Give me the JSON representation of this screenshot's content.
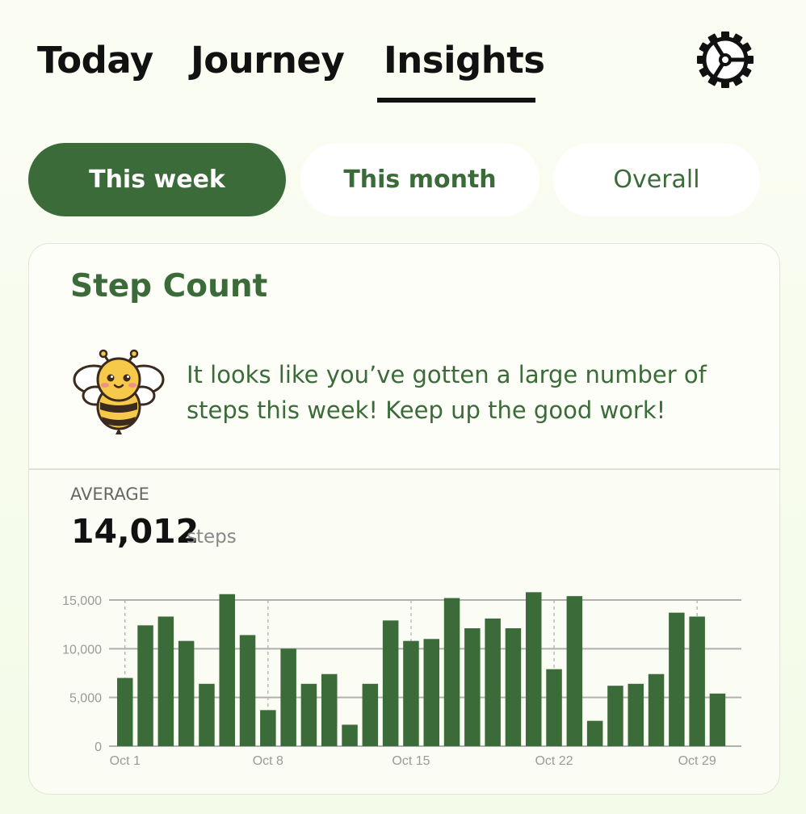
{
  "tabs": {
    "today": "Today",
    "journey": "Journey",
    "insights": "Insights",
    "active": "Insights"
  },
  "filters": {
    "this_week": "This week",
    "this_month": "This month",
    "overall": "Overall",
    "selected": "This week"
  },
  "card": {
    "title": "Step Count",
    "message": "It looks like you’ve gotten a large number of steps this week! Keep up the good work!",
    "average_label": "AVERAGE",
    "average_value": "14,012",
    "average_unit": "steps"
  },
  "icons": {
    "settings": "gear-icon",
    "mascot": "bee-icon"
  },
  "colors": {
    "accent": "#3a6b39",
    "bar": "#3a6b39"
  },
  "chart_data": {
    "type": "bar",
    "categories": [
      "Oct 1",
      "Oct 2",
      "Oct 3",
      "Oct 4",
      "Oct 5",
      "Oct 6",
      "Oct 7",
      "Oct 8",
      "Oct 9",
      "Oct 10",
      "Oct 11",
      "Oct 12",
      "Oct 13",
      "Oct 14",
      "Oct 15",
      "Oct 16",
      "Oct 17",
      "Oct 18",
      "Oct 19",
      "Oct 20",
      "Oct 21",
      "Oct 22",
      "Oct 23",
      "Oct 24",
      "Oct 25",
      "Oct 26",
      "Oct 27",
      "Oct 28",
      "Oct 29",
      "Oct 30"
    ],
    "values": [
      7000,
      12400,
      13300,
      10800,
      6400,
      15600,
      11400,
      3700,
      10000,
      6400,
      7400,
      2200,
      6400,
      12900,
      10800,
      11000,
      15200,
      12100,
      13100,
      12100,
      15800,
      7900,
      15400,
      2600,
      6200,
      6400,
      7400,
      13700,
      13300,
      5400
    ],
    "x_tick_labels": [
      "Oct 1",
      "Oct 8",
      "Oct 15",
      "Oct 22",
      "Oct 29"
    ],
    "y_tick_labels": [
      "0",
      "5,000",
      "10,000",
      "15,000"
    ],
    "y_ticks": [
      0,
      5000,
      10000,
      15000
    ],
    "ylim": [
      0,
      15000
    ],
    "grid": true
  }
}
